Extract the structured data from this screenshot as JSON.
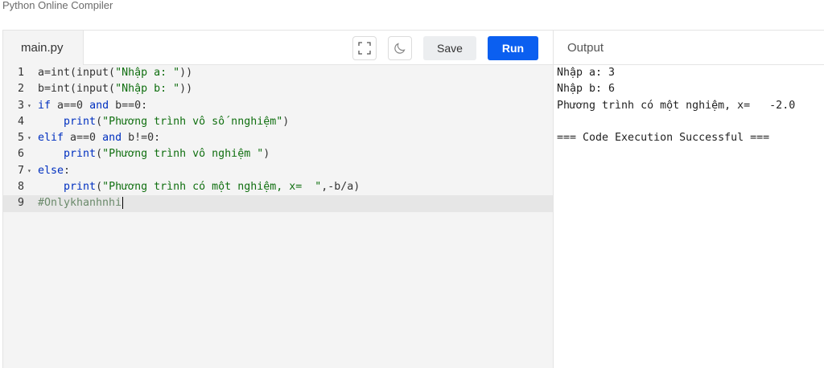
{
  "app": {
    "title": "Python Online Compiler"
  },
  "editor": {
    "file_tab": "main.py",
    "save_label": "Save",
    "run_label": "Run",
    "icons": {
      "fullscreen": "fullscreen-icon",
      "theme": "moon-icon"
    },
    "lines": [
      {
        "num": "1",
        "fold": "",
        "tokens": [
          {
            "t": "fn",
            "v": "a=int(input("
          },
          {
            "t": "str",
            "v": "\"Nhập a: \""
          },
          {
            "t": "fn",
            "v": "))"
          }
        ]
      },
      {
        "num": "2",
        "fold": "",
        "tokens": [
          {
            "t": "fn",
            "v": "b=int(input("
          },
          {
            "t": "str",
            "v": "\"Nhập b: \""
          },
          {
            "t": "fn",
            "v": "))"
          }
        ]
      },
      {
        "num": "3",
        "fold": "▾",
        "tokens": [
          {
            "t": "kw",
            "v": "if"
          },
          {
            "t": "fn",
            "v": " a==0 "
          },
          {
            "t": "kw",
            "v": "and"
          },
          {
            "t": "fn",
            "v": " b==0:"
          }
        ]
      },
      {
        "num": "4",
        "fold": "",
        "tokens": [
          {
            "t": "fn",
            "v": "    "
          },
          {
            "t": "kw",
            "v": "print"
          },
          {
            "t": "fn",
            "v": "("
          },
          {
            "t": "str",
            "v": "\"Phương trình vô số nnghiệm\""
          },
          {
            "t": "fn",
            "v": ")"
          }
        ]
      },
      {
        "num": "5",
        "fold": "▾",
        "tokens": [
          {
            "t": "kw",
            "v": "elif"
          },
          {
            "t": "fn",
            "v": " a==0 "
          },
          {
            "t": "kw",
            "v": "and"
          },
          {
            "t": "fn",
            "v": " b!=0:"
          }
        ]
      },
      {
        "num": "6",
        "fold": "",
        "tokens": [
          {
            "t": "fn",
            "v": "    "
          },
          {
            "t": "kw",
            "v": "print"
          },
          {
            "t": "fn",
            "v": "("
          },
          {
            "t": "str",
            "v": "\"Phương trình vô nghiệm \""
          },
          {
            "t": "fn",
            "v": ")"
          }
        ]
      },
      {
        "num": "7",
        "fold": "▾",
        "tokens": [
          {
            "t": "kw",
            "v": "else"
          },
          {
            "t": "fn",
            "v": ":"
          }
        ]
      },
      {
        "num": "8",
        "fold": "",
        "tokens": [
          {
            "t": "fn",
            "v": "    "
          },
          {
            "t": "kw",
            "v": "print"
          },
          {
            "t": "fn",
            "v": "("
          },
          {
            "t": "str",
            "v": "\"Phương trình có một nghiệm, x=  \""
          },
          {
            "t": "fn",
            "v": ",-b/a)"
          }
        ]
      },
      {
        "num": "9",
        "fold": "",
        "active": true,
        "tokens": [
          {
            "t": "cmt",
            "v": "#Onlykhanhnhi"
          }
        ]
      }
    ]
  },
  "output": {
    "title": "Output",
    "lines": [
      "Nhập a: 3",
      "Nhập b: 6",
      "Phương trình có một nghiệm, x=   -2.0",
      "",
      "=== Code Execution Successful ==="
    ]
  }
}
